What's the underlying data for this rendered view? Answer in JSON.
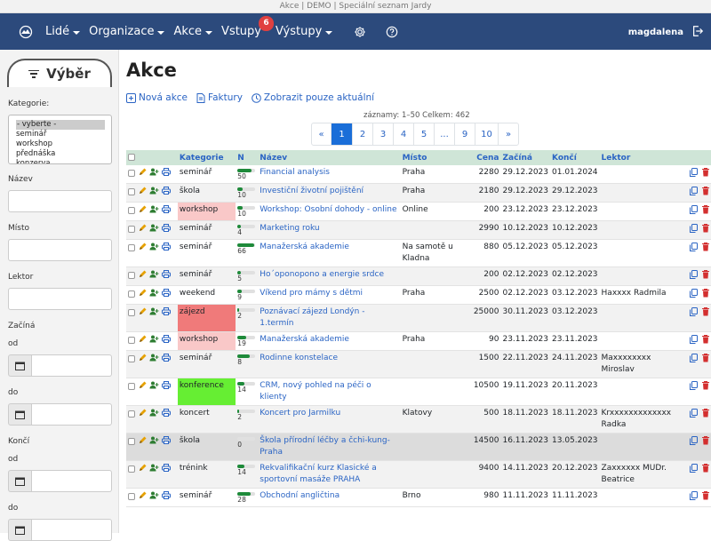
{
  "window_title": "Akce | DEMO | Speciální seznam Jardy",
  "nav": {
    "items": [
      {
        "label": "Lidé",
        "dropdown": true
      },
      {
        "label": "Organizace",
        "dropdown": true
      },
      {
        "label": "Akce",
        "dropdown": true
      },
      {
        "label": "Vstupy",
        "dropdown": false,
        "badge": "6"
      },
      {
        "label": "Výstupy",
        "dropdown": true
      }
    ],
    "user": "magdalena"
  },
  "sidebar": {
    "tab_label": "Výběr",
    "kategorie_label": "Kategorie:",
    "kategorie_options": [
      "- vyberte -",
      "seminář",
      "workshop",
      "přednáška",
      "konzerva"
    ],
    "nazev_label": "Název",
    "misto_label": "Místo",
    "lektor_label": "Lektor",
    "zacina_label": "Začíná",
    "od_label": "od",
    "do_label": "do",
    "konci_label": "Končí",
    "od2_label": "od",
    "do2_label": "do"
  },
  "main": {
    "title": "Akce",
    "actions": {
      "new": "Nová akce",
      "invoices": "Faktury",
      "current": "Zobrazit pouze aktuální"
    },
    "summary": "záznamy: 1–50   Celkem: 462",
    "pagination": [
      "«",
      "1",
      "2",
      "3",
      "4",
      "5",
      "...",
      "9",
      "10",
      "»"
    ],
    "active_page": "1"
  },
  "table": {
    "headers": {
      "kategorie": "Kategorie",
      "n": "N",
      "nazev": "Název",
      "misto": "Místo",
      "cena": "Cena",
      "zacina": "Začíná",
      "konci": "Končí",
      "lektor": "Lektor"
    },
    "rows": [
      {
        "kategorie": "seminář",
        "n": "50",
        "fill": 0.8,
        "nazev": "Financial analysis",
        "misto": "Praha",
        "cena": "2280",
        "zacina": "29.12.2023",
        "konci": "01.01.2024",
        "lektor": "",
        "cat_color": ""
      },
      {
        "kategorie": "škola",
        "n": "10",
        "fill": 0.3,
        "nazev": "Investiční životní pojištění",
        "misto": "Praha",
        "cena": "2180",
        "zacina": "29.12.2023",
        "konci": "29.12.2023",
        "lektor": "",
        "cat_color": ""
      },
      {
        "kategorie": "workshop",
        "n": "10",
        "fill": 0.3,
        "nazev": "Workshop: Osobní dohody - online",
        "misto": "Online",
        "cena": "200",
        "zacina": "23.12.2023",
        "konci": "23.12.2023",
        "lektor": "",
        "cat_color": "pink"
      },
      {
        "kategorie": "seminář",
        "n": "4",
        "fill": 0.2,
        "nazev": "Marketing roku",
        "misto": "",
        "cena": "2990",
        "zacina": "10.12.2023",
        "konci": "10.12.2023",
        "lektor": "",
        "cat_color": ""
      },
      {
        "kategorie": "seminář",
        "n": "66",
        "fill": 0.95,
        "nazev": "Manažerská akademie",
        "misto": "Na samotě u Kladna",
        "cena": "880",
        "zacina": "05.12.2023",
        "konci": "05.12.2023",
        "lektor": "",
        "cat_color": ""
      },
      {
        "kategorie": "seminář",
        "n": "5",
        "fill": 0.2,
        "nazev": "Ho´oponopono a energie srdce",
        "misto": "",
        "cena": "200",
        "zacina": "02.12.2023",
        "konci": "02.12.2023",
        "lektor": "",
        "cat_color": ""
      },
      {
        "kategorie": "weekend",
        "n": "9",
        "fill": 0.25,
        "nazev": "Víkend pro mámy s dětmi",
        "misto": "Praha",
        "cena": "2500",
        "zacina": "02.12.2023",
        "konci": "03.12.2023",
        "lektor": "Haxxxx Radmila",
        "cat_color": ""
      },
      {
        "kategorie": "zájezd",
        "n": "2",
        "fill": 0.1,
        "nazev": "Poznávací zájezd Londýn - 1.termín",
        "misto": "",
        "cena": "25000",
        "zacina": "30.11.2023",
        "konci": "03.12.2023",
        "lektor": "",
        "cat_color": "red"
      },
      {
        "kategorie": "workshop",
        "n": "19",
        "fill": 0.5,
        "nazev": "Manažerská akademie",
        "misto": "Praha",
        "cena": "90",
        "zacina": "23.11.2023",
        "konci": "23.11.2023",
        "lektor": "",
        "cat_color": "pink"
      },
      {
        "kategorie": "seminář",
        "n": "8",
        "fill": 0.7,
        "nazev": "Rodinne konstelace",
        "misto": "",
        "cena": "1500",
        "zacina": "22.11.2023",
        "konci": "24.11.2023",
        "lektor": "Maxxxxxxxx Miroslav",
        "cat_color": ""
      },
      {
        "kategorie": "konference",
        "n": "14",
        "fill": 0.4,
        "nazev": "CRM, nový pohled na péči o klienty",
        "misto": "",
        "cena": "10500",
        "zacina": "19.11.2023",
        "konci": "20.11.2023",
        "lektor": "",
        "cat_color": "green"
      },
      {
        "kategorie": "koncert",
        "n": "2",
        "fill": 0.1,
        "nazev": "Koncert pro Jarmilku",
        "misto": "Klatovy",
        "cena": "500",
        "zacina": "18.11.2023",
        "konci": "18.11.2023",
        "lektor": "Krxxxxxxxxxxxxx Radka",
        "cat_color": ""
      },
      {
        "kategorie": "škola",
        "n": "0",
        "fill": 0.0,
        "nazev": "Škola přírodní léčby a čchi-kung-Praha",
        "misto": "",
        "cena": "14500",
        "zacina": "16.11.2023",
        "konci": "13.05.2023",
        "lektor": "",
        "cat_color": "",
        "grey": true
      },
      {
        "kategorie": "trénink",
        "n": "14",
        "fill": 0.4,
        "nazev": "Rekvalifikační kurz Klasické a sportovní masáže PRAHA",
        "misto": "",
        "cena": "9400",
        "zacina": "14.11.2023",
        "konci": "20.12.2023",
        "lektor": "Zaxxxxxx MUDr. Beatrice",
        "cat_color": ""
      },
      {
        "kategorie": "seminář",
        "n": "28",
        "fill": 0.75,
        "nazev": "Obchodní angličtina",
        "misto": "Brno",
        "cena": "980",
        "zacina": "11.11.2023",
        "konci": "11.11.2023",
        "lektor": "",
        "cat_color": ""
      }
    ]
  },
  "colors": {
    "navbar": "#2c4a7c",
    "accent": "#2a64c4",
    "header_bg": "#cfe5d7",
    "badge": "#e04040"
  }
}
